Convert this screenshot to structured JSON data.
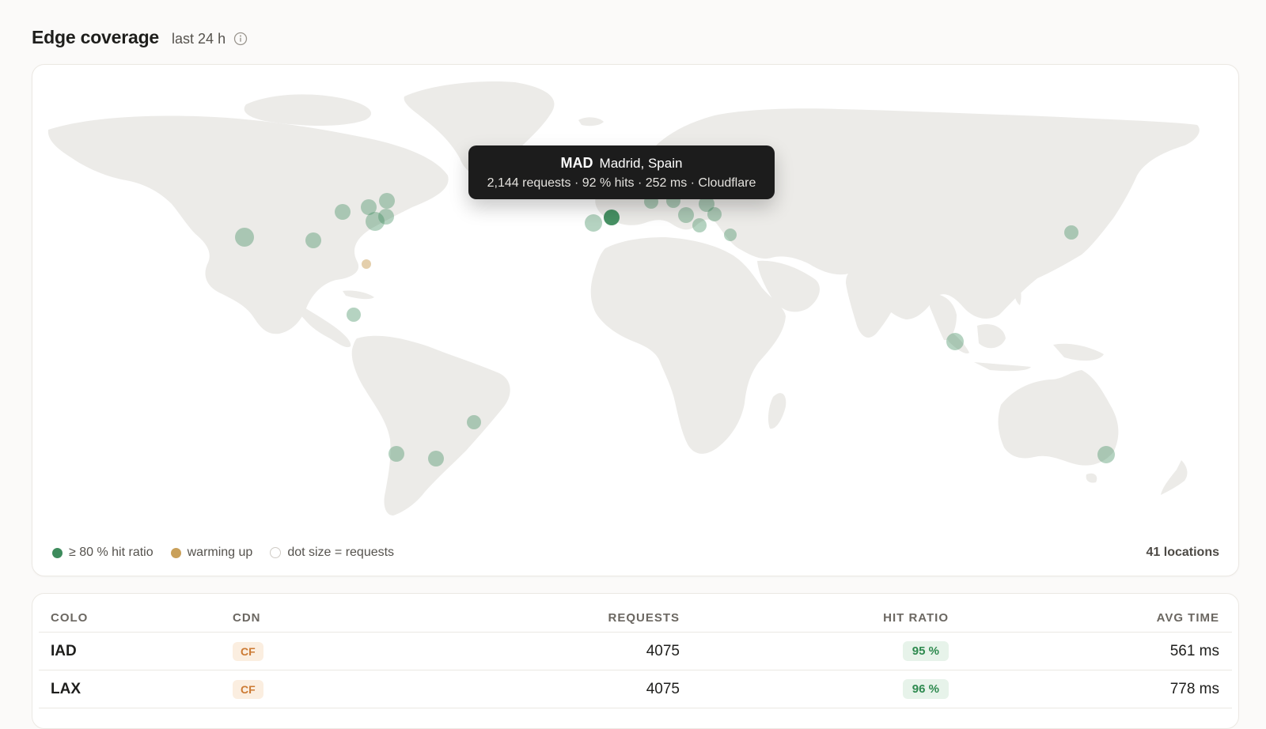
{
  "header": {
    "title": "Edge coverage",
    "range": "last 24 h"
  },
  "tooltip": {
    "code": "MAD",
    "place": "Madrid, Spain",
    "stats": "2,144 requests · 92 % hits · 252 ms · Cloudflare"
  },
  "legend": {
    "healthy": "≥ 80 % hit ratio",
    "warming": "warming up",
    "size": "dot size = requests",
    "count": "41 locations"
  },
  "colors": {
    "healthy": "#3d8b5c",
    "warming": "#c9a05a",
    "land": "#ecebe8",
    "cdn_badge": "#cc7a33",
    "hit_badge": "#2e8a4f"
  },
  "table": {
    "columns": [
      "COLO",
      "CDN",
      "REQUESTS",
      "HIT RATIO",
      "AVG TIME"
    ],
    "rows": [
      {
        "colo": "IAD",
        "cdn": "CF",
        "requests": "4075",
        "hit_ratio": "95 %",
        "avg_time": "561 ms"
      },
      {
        "colo": "LAX",
        "cdn": "CF",
        "requests": "4075",
        "hit_ratio": "96 %",
        "avg_time": "778 ms"
      }
    ]
  }
}
